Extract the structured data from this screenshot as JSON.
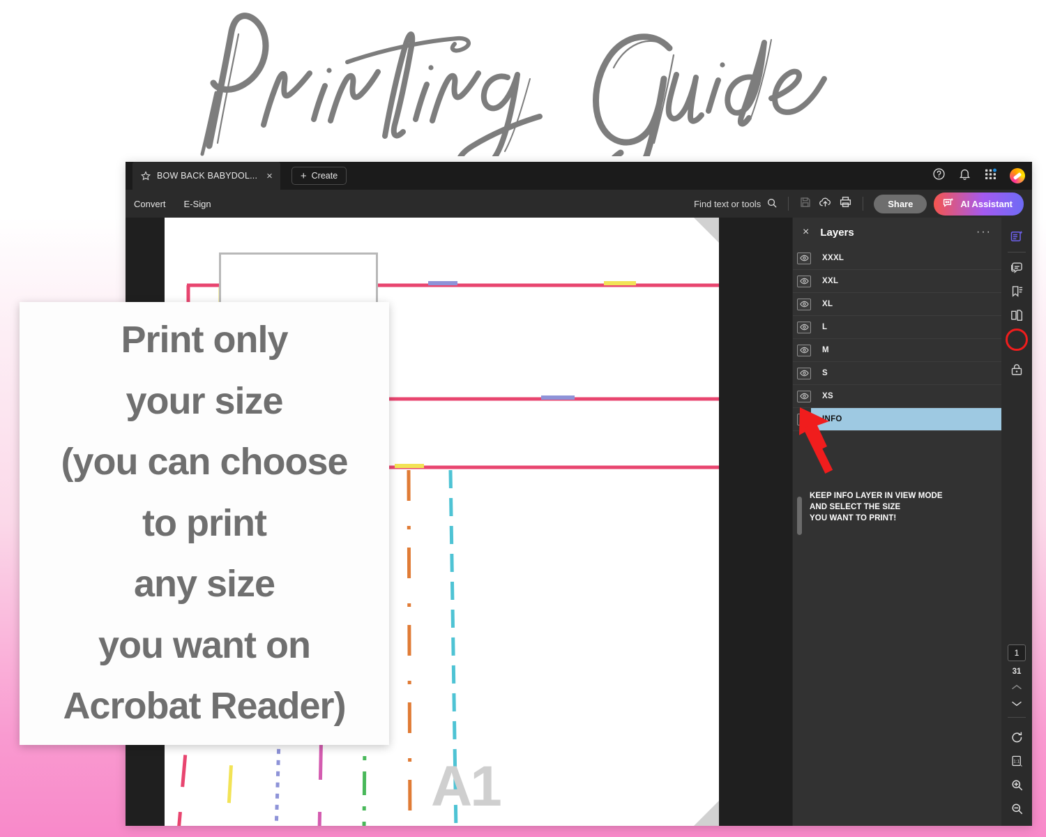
{
  "banner": {
    "headline": "Printing Guide"
  },
  "callout": {
    "lines": [
      "Print only",
      "your size",
      "(you can choose",
      "to print",
      "any size",
      "you want on",
      "Acrobat Reader)"
    ]
  },
  "window": {
    "titlebar": {
      "star_icon": "star-icon",
      "tab_title": "BOW BACK BABYDOL...",
      "tab_close": "×",
      "create_label": "Create",
      "create_plus": "+",
      "help_icon": "help-circle-icon",
      "bell_icon": "bell-icon",
      "apps_icon": "app-grid-icon",
      "avatar": "user-avatar"
    },
    "toolbar": {
      "menus": [
        "Convert",
        "E-Sign"
      ],
      "find_label": "Find text or tools",
      "search_icon": "search-icon",
      "save_icon": "save-icon",
      "cloud_icon": "cloud-upload-icon",
      "print_icon": "print-icon",
      "share_label": "Share",
      "ai_label": "AI Assistant",
      "ai_icon": "ai-sparkle-icon"
    }
  },
  "document": {
    "watermark": "A1",
    "page_nav_top": "previous-page-arrow",
    "page_nav_bottom": "next-page-arrow"
  },
  "layers_panel": {
    "close_icon": "×",
    "title": "Layers",
    "more_icon": "···",
    "items": [
      {
        "label": "XXXL",
        "visible": true,
        "selected": false
      },
      {
        "label": "XXL",
        "visible": true,
        "selected": false
      },
      {
        "label": "XL",
        "visible": true,
        "selected": false
      },
      {
        "label": "L",
        "visible": true,
        "selected": false
      },
      {
        "label": "M",
        "visible": true,
        "selected": false
      },
      {
        "label": "S",
        "visible": true,
        "selected": false
      },
      {
        "label": "XS",
        "visible": true,
        "selected": false
      },
      {
        "label": "INFO",
        "visible": true,
        "selected": true
      }
    ],
    "annotation": "KEEP INFO LAYER IN VIEW MODE\nAND SELECT THE SIZE\nYOU WANT TO PRINT!",
    "annotation_arrow": "red-arrow-pointing-to-info-eye"
  },
  "rail": {
    "icons": [
      "edit-document-icon",
      "comment-icon",
      "bookmark-icon",
      "pages-icon",
      "layers-icon",
      "protect-lock-icon"
    ],
    "active_icon": "layers-icon",
    "page_current": "1",
    "page_total": "31",
    "up_icon": "chevron-up-icon",
    "down_icon": "chevron-down-icon",
    "rotate_icon": "rotate-icon",
    "fit_icon": "fit-one-to-one-icon",
    "zoom_in_icon": "zoom-in-icon",
    "zoom_out_icon": "zoom-out-icon"
  },
  "colors": {
    "accent_pink": "#f889c9",
    "selection_blue": "#9ec9e2",
    "arrow_red": "#f01d1d",
    "active_ring": "#f01d1d",
    "headline_grey": "#7d7d7d",
    "pattern": [
      "#e8456f",
      "#f2e356",
      "#8e93d8",
      "#d濃"
    ]
  },
  "pattern_data": {
    "line_colors": [
      "#e8456f",
      "#f2e356",
      "#8e93d8",
      "#d45cb0",
      "#49b85a",
      "#e07b35",
      "#4ec3d4"
    ],
    "description": "multi-size sewing pattern lines"
  }
}
